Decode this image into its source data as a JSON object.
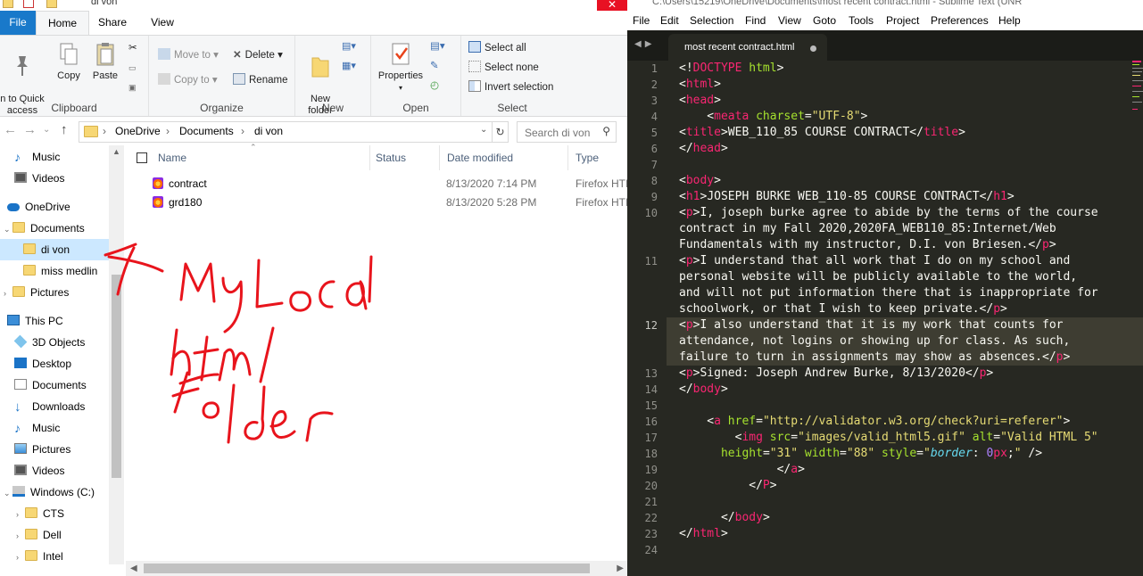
{
  "explorer": {
    "title": "di von",
    "tabs": {
      "file": "File",
      "home": "Home",
      "share": "Share",
      "view": "View"
    },
    "ribbon": {
      "clipboard": {
        "label": "Clipboard",
        "pin": "n to Quick\naccess",
        "copy": "Copy",
        "paste": "Paste"
      },
      "organize": {
        "label": "Organize",
        "move_to": "Move to",
        "copy_to": "Copy to",
        "delete": "Delete",
        "rename": "Rename"
      },
      "new": {
        "label": "New",
        "new_folder": "New\nfolder"
      },
      "open": {
        "label": "Open",
        "properties": "Properties"
      },
      "select": {
        "label": "Select",
        "select_all": "Select all",
        "select_none": "Select none",
        "invert": "Invert selection"
      }
    },
    "address": {
      "crumbs": [
        "OneDrive",
        "Documents",
        "di von"
      ],
      "search_placeholder": "Search di von"
    },
    "nav": [
      {
        "label": "Music",
        "icon": "music-icon"
      },
      {
        "label": "Videos",
        "icon": "videos-icon"
      },
      {
        "label": "OneDrive",
        "icon": "cloud-icon"
      },
      {
        "label": "Documents",
        "icon": "folder-icon"
      },
      {
        "label": "di von",
        "icon": "folder-icon",
        "selected": true
      },
      {
        "label": "miss medlin",
        "icon": "folder-icon"
      },
      {
        "label": "Pictures",
        "icon": "folder-icon"
      },
      {
        "label": "This PC",
        "icon": "computer-icon"
      },
      {
        "label": "3D Objects",
        "icon": "cube-icon"
      },
      {
        "label": "Desktop",
        "icon": "desktop-icon"
      },
      {
        "label": "Documents",
        "icon": "documents-icon"
      },
      {
        "label": "Downloads",
        "icon": "download-icon"
      },
      {
        "label": "Music",
        "icon": "music-icon"
      },
      {
        "label": "Pictures",
        "icon": "pictures-icon"
      },
      {
        "label": "Videos",
        "icon": "videos-icon"
      },
      {
        "label": "Windows (C:)",
        "icon": "drive-icon"
      },
      {
        "label": "CTS",
        "icon": "folder-icon"
      },
      {
        "label": "Dell",
        "icon": "folder-icon"
      },
      {
        "label": "Intel",
        "icon": "folder-icon"
      }
    ],
    "columns": {
      "name": "Name",
      "status": "Status",
      "date": "Date modified",
      "type": "Type"
    },
    "files": [
      {
        "name": "contract",
        "date": "8/13/2020 7:14 PM",
        "type": "Firefox HTI"
      },
      {
        "name": "grd180",
        "date": "8/13/2020 5:28 PM",
        "type": "Firefox HTI"
      }
    ],
    "annotation_color": "#e8141c"
  },
  "sublime": {
    "title": "C:\\Users\\15219\\OneDrive\\Documents\\most recent contract.html - Sublime Text (UNR",
    "menu": [
      "File",
      "Edit",
      "Selection",
      "Find",
      "View",
      "Goto",
      "Tools",
      "Project",
      "Preferences",
      "Help"
    ],
    "tab": "most recent contract.html",
    "line_numbers": [
      "1",
      "2",
      "3",
      "4",
      "5",
      "6",
      "7",
      "8",
      "9",
      "10",
      "11",
      "12",
      "13",
      "14",
      "15",
      "16",
      "17",
      "18",
      "19",
      "20",
      "21",
      "22",
      "23",
      "24"
    ],
    "lines": {
      "l1": "html",
      "l4_attr": "charset",
      "l4_val": "\"UTF-8\"",
      "l5_text": "WEB_110_85 COURSE CONTRACT",
      "l9_text": "JOSEPH BURKE WEB_110-85 COURSE CONTRACT",
      "l10_a": "I, joseph burke agree to abide by the terms of the course",
      "l10_b": "contract in my Fall 2020,2020FA_WEB110_85:Internet/Web",
      "l10_c": "Fundamentals with my instructor, D.I. von Briesen.",
      "l11_a": "I understand that all work that I do on my school and",
      "l11_b": "personal website will be publicly available to the world,",
      "l11_c": "and will not put information there that is inappropriate for",
      "l11_d": "schoolwork, or that I wish to keep private.",
      "l12_a": "I also understand that it is my work that counts for",
      "l12_b": "attendance, not logins or showing up for class. As such,",
      "l12_c": "failure to turn in assignments may show as absences.",
      "l13_text": "Signed: Joseph Andrew Burke, 8/13/2020",
      "l16_href": "\"http://validator.w3.org/check?uri=referer\"",
      "l17_src": "\"images/valid_html5.gif\"",
      "l17_alt": "\"Valid HTML 5\"",
      "l18_h": "\"31\"",
      "l18_w": "\"88\"",
      "l18_num": "0",
      "l18_unit": "px"
    },
    "colors": {
      "background": "#272822",
      "tag": "#f92672",
      "attribute": "#a6e22e",
      "string": "#e6db74"
    }
  }
}
